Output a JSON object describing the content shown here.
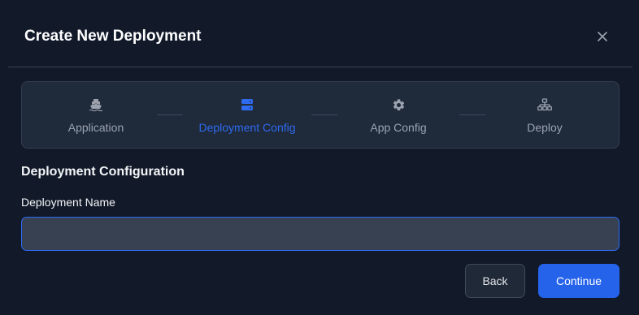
{
  "modal": {
    "title": "Create New Deployment",
    "close_icon": "close-icon"
  },
  "stepper": {
    "steps": [
      {
        "label": "Application",
        "icon": "ship-icon",
        "active": false
      },
      {
        "label": "Deployment Config",
        "icon": "server-icon",
        "active": true
      },
      {
        "label": "App Config",
        "icon": "gear-icon",
        "active": false
      },
      {
        "label": "Deploy",
        "icon": "network-icon",
        "active": false
      }
    ]
  },
  "form": {
    "section_heading": "Deployment Configuration",
    "deployment_name": {
      "label": "Deployment Name",
      "value": "",
      "placeholder": ""
    }
  },
  "actions": {
    "back_label": "Back",
    "continue_label": "Continue"
  },
  "colors": {
    "background": "#121a2a",
    "accent": "#2563eb",
    "active_step": "#2f6bf0",
    "muted_text": "#9ca3af"
  }
}
